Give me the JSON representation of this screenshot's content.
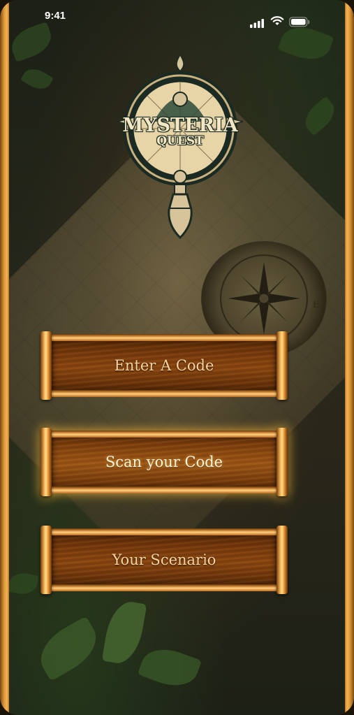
{
  "status_bar": {
    "time": "9:41",
    "signal_icon": "cellular-signal-icon",
    "wifi_icon": "wifi-icon",
    "battery_icon": "battery-icon"
  },
  "logo": {
    "line1": "MYSTERIA",
    "line2": "QUEST",
    "icon": "magnifying-glass-compass-logo"
  },
  "menu": {
    "enter_code": "Enter A Code",
    "scan_code": "Scan your Code",
    "your_scenario": "Your Scenario"
  },
  "colors": {
    "frame_gold": "#f3b454",
    "button_wood": "#7a3a0c",
    "button_text": "#f6d6a0",
    "logo_teal": "#1b2a22",
    "logo_cream": "#f4e7c4"
  }
}
